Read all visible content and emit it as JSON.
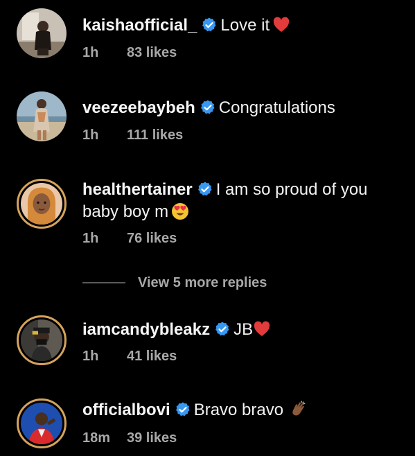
{
  "comments": [
    {
      "username": "kaishaofficial_",
      "text": "Love it",
      "emoji": "red-heart-icon",
      "time": "1h",
      "likes": "83 likes"
    },
    {
      "username": "veezeebaybeh",
      "text": "Congratulations",
      "time": "1h",
      "likes": "111 likes"
    },
    {
      "username": "healthertainer",
      "text": "I am so proud of you baby boy m",
      "emoji": "heart-eyes-icon",
      "time": "1h",
      "likes": "76 likes"
    },
    {
      "username": "iamcandybleakz",
      "text": "JB",
      "emoji": "red-heart-icon",
      "time": "1h",
      "likes": "41 likes"
    },
    {
      "username": "officialbovi",
      "text": "Bravo bravo",
      "emoji": "clapping-hand-icon",
      "time": "18m",
      "likes": "39 likes"
    }
  ],
  "view_more": "View 5 more replies",
  "colors": {
    "background": "#000000",
    "verified_badge": "#3897f0",
    "meta_text": "#a8a8a8",
    "story_ring": "#d6a35c"
  }
}
